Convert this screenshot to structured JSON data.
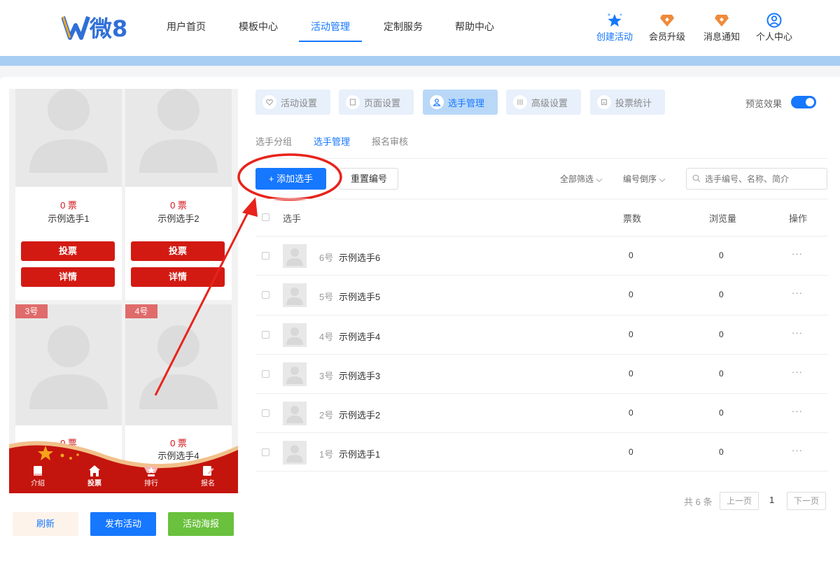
{
  "header": {
    "logo_text": "微8",
    "nav": [
      "用户首页",
      "模板中心",
      "活动管理",
      "定制服务",
      "帮助中心"
    ],
    "nav_active": 2,
    "tools": [
      "创建活动",
      "会员升级",
      "消息通知",
      "个人中心"
    ]
  },
  "preview": {
    "cards": [
      {
        "votes": "0 票",
        "name": "示例选手1",
        "vote_btn": "投票",
        "detail_btn": "详情"
      },
      {
        "votes": "0 票",
        "name": "示例选手2",
        "vote_btn": "投票",
        "detail_btn": "详情"
      },
      {
        "badge": "3号",
        "votes": "0 票",
        "name": ""
      },
      {
        "badge": "4号",
        "votes": "0 票",
        "name": "示例选手4"
      }
    ],
    "footer": [
      "介绍",
      "投票",
      "排行",
      "报名"
    ]
  },
  "left_buttons": {
    "refresh": "刷新",
    "publish": "发布活动",
    "poster": "活动海报"
  },
  "tabs": [
    "活动设置",
    "页面设置",
    "选手管理",
    "高级设置",
    "投票统计"
  ],
  "tab_active": 2,
  "preview_toggle": {
    "label": "预览效果",
    "on": true
  },
  "subtabs": [
    "选手分组",
    "选手管理",
    "报名审核"
  ],
  "subtab_active": 1,
  "toolbar": {
    "add": "+ 添加选手",
    "renumber": "重置编号",
    "filter_all": "全部筛选",
    "filter_order": "编号倒序",
    "search_placeholder": "选手编号、名称、简介"
  },
  "table": {
    "headers": {
      "player": "选手",
      "votes": "票数",
      "views": "浏览量",
      "actions": "操作"
    },
    "rows": [
      {
        "num": "6号",
        "name": "示例选手6",
        "votes": "0",
        "views": "0",
        "more": "···"
      },
      {
        "num": "5号",
        "name": "示例选手5",
        "votes": "0",
        "views": "0",
        "more": "···"
      },
      {
        "num": "4号",
        "name": "示例选手4",
        "votes": "0",
        "views": "0",
        "more": "···"
      },
      {
        "num": "3号",
        "name": "示例选手3",
        "votes": "0",
        "views": "0",
        "more": "···"
      },
      {
        "num": "2号",
        "name": "示例选手2",
        "votes": "0",
        "views": "0",
        "more": "···"
      },
      {
        "num": "1号",
        "name": "示例选手1",
        "votes": "0",
        "views": "0",
        "more": "···"
      }
    ]
  },
  "pagination": {
    "total": "共 6 条",
    "prev": "上一页",
    "page": "1",
    "next": "下一页"
  },
  "colors": {
    "accent": "#1677ff",
    "vote_red": "#d21a12",
    "refresh_bg": "#fdf3ea",
    "poster_green": "#6ac13d"
  }
}
